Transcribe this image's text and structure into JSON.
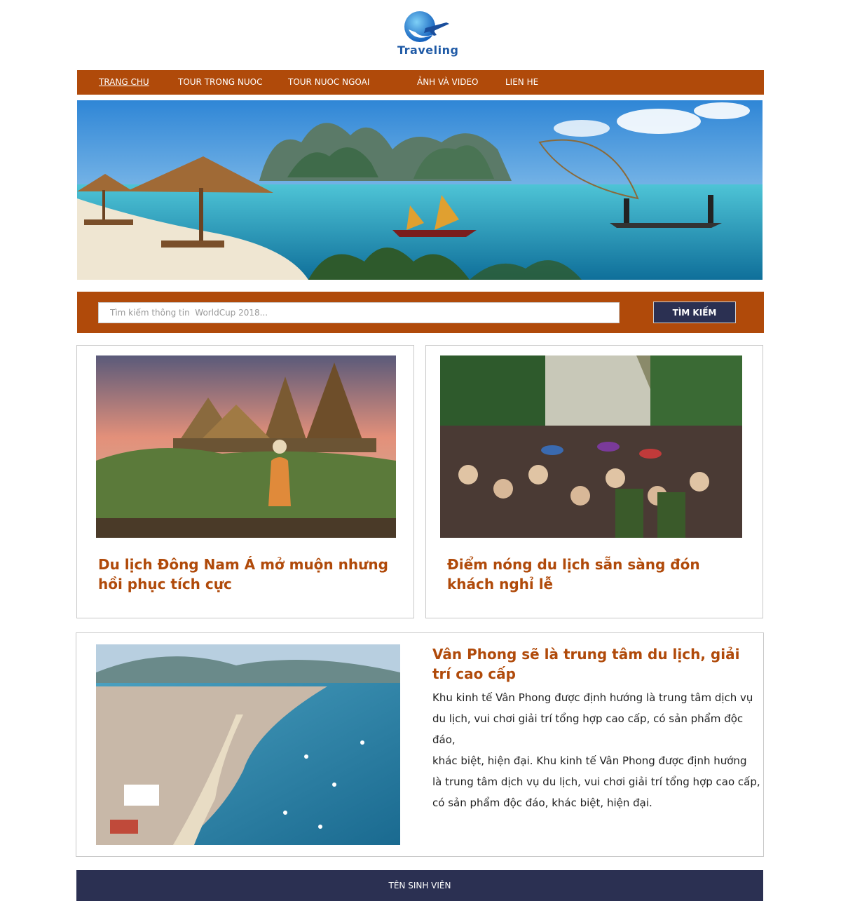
{
  "logo": {
    "text": "Traveling",
    "icon": "plane-logo-icon"
  },
  "nav": {
    "items": [
      {
        "label": "TRANG CHU",
        "active": true
      },
      {
        "label": "TOUR TRONG NUOC",
        "active": false
      },
      {
        "label": "TOUR NUOC NGOAI",
        "active": false
      },
      {
        "label": "ẢNH VÀ VIDEO",
        "active": false
      },
      {
        "label": "LIEN HE",
        "active": false
      }
    ]
  },
  "search": {
    "placeholder": "Tìm kiếm thông tin  WorldCup 2018...",
    "button_label": "TÌM KIẾM"
  },
  "articles": [
    {
      "title": "Du lịch Đông Nam Á mở muộn nhưng hồi phục tích cực"
    },
    {
      "title": "Điểm nóng du lịch sẵn sàng đón khách nghỉ lễ"
    }
  ],
  "featured": {
    "title": "Vân Phong sẽ là trung tâm du lịch, giải trí cao cấp",
    "desc_lines": [
      "Khu kinh tế Vân Phong được định hướng là trung tâm dịch vụ",
      "du lịch, vui chơi giải trí tổng hợp cao cấp, có sản phẩm độc đáo,",
      "khác biệt, hiện đại. Khu kinh tế Vân Phong được định hướng",
      "là trung tâm dịch vụ du lịch, vui chơi giải trí tổng hợp cao cấp,",
      "có sản phẩm độc đáo, khác biệt, hiện đại."
    ]
  },
  "footer": {
    "label": "TÊN SINH VIÊN"
  },
  "colors": {
    "brand": "#b04a0a",
    "navy": "#2b3052"
  }
}
